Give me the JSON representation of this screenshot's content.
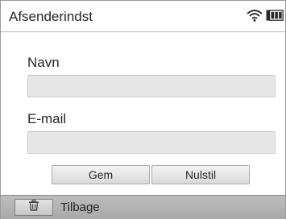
{
  "header": {
    "title": "Afsenderindst",
    "icons": [
      "wifi-icon",
      "battery-icon"
    ]
  },
  "form": {
    "name_label": "Navn",
    "name_value": "",
    "email_label": "E-mail",
    "email_value": ""
  },
  "buttons": {
    "save_label": "Gem",
    "reset_label": "Nulstil"
  },
  "footer": {
    "back_icon": "trash-icon",
    "back_label": "Tilbage"
  }
}
